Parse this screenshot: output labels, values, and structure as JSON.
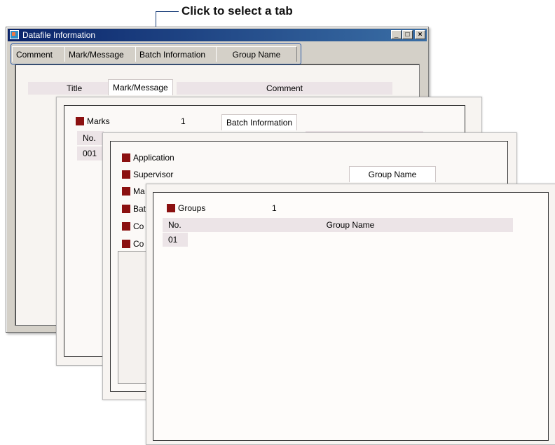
{
  "callout": {
    "text": "Click to select a tab"
  },
  "window": {
    "title": "Datafile Information",
    "buttons": {
      "minimize": "_",
      "maximize": "□",
      "close": "×"
    },
    "tabs": [
      "Comment",
      "Mark/Message",
      "Batch Information",
      "Group Name"
    ]
  },
  "comment_page": {
    "headers": [
      "Title",
      "Mark/Message",
      "Comment"
    ]
  },
  "mark_page": {
    "tab_label": "Batch Information",
    "marks_label": "Marks",
    "marks_count": "1",
    "col_no": "No.",
    "row_no": "001"
  },
  "batch_page": {
    "tab_label": "Group Name",
    "items": [
      "Application",
      "Supervisor",
      "Ma",
      "Bat",
      "Co",
      "Co"
    ]
  },
  "group_page": {
    "groups_label": "Groups",
    "groups_count": "1",
    "col_no": "No.",
    "col_group_name": "Group Name",
    "row_no": "01"
  },
  "colors": {
    "marker": "#8b1010",
    "header_bg": "#ece4e7",
    "titlebar": "#0a246a"
  }
}
